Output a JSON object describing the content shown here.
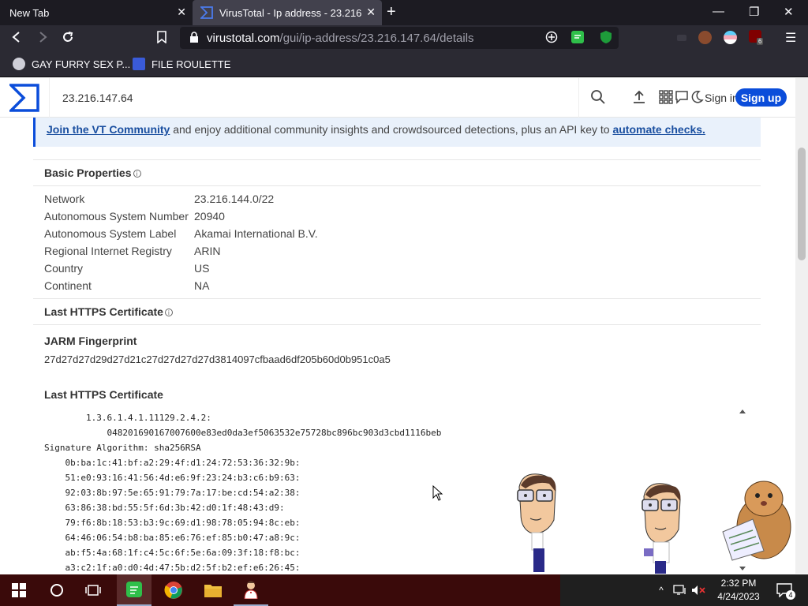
{
  "browser": {
    "tabs": [
      {
        "title": "New Tab",
        "active": false
      },
      {
        "title": "VirusTotal - Ip address - 23.216",
        "active": true
      }
    ],
    "url_host": "virustotal.com",
    "url_path": "/gui/ip-address/23.216.147.64/details",
    "bookmarks": [
      {
        "label": "GAY FURRY SEX P..."
      },
      {
        "label": "FILE ROULETTE"
      }
    ],
    "extension_badge": "6"
  },
  "vt": {
    "search_value": "23.216.147.64",
    "signin_label": "Sign in",
    "signup_label": "Sign up",
    "banner": {
      "link1": "Join the VT Community",
      "text": " and enjoy additional community insights and crowdsourced detections, plus an API key to ",
      "link2": "automate checks."
    },
    "basic_properties": {
      "title": "Basic Properties",
      "info_glyph": "i",
      "rows": [
        {
          "label": "Network",
          "value": "23.216.144.0/22"
        },
        {
          "label": "Autonomous System Number",
          "value": "20940"
        },
        {
          "label": "Autonomous System Label",
          "value": "Akamai International B.V."
        },
        {
          "label": "Regional Internet Registry",
          "value": "ARIN"
        },
        {
          "label": "Country",
          "value": "US"
        },
        {
          "label": "Continent",
          "value": "NA"
        }
      ]
    },
    "last_https_cert_heading": "Last HTTPS Certificate",
    "jarm": {
      "title": "JARM Fingerprint",
      "value": "27d27d27d29d27d21c27d27d27d27d3814097cfbaad6df205b60d0b951c0a5"
    },
    "cert_section_title": "Last HTTPS Certificate",
    "cert_lines": [
      "        1.3.6.1.4.1.11129.2.4.2:",
      "            048201690167007600e83ed0da3ef5063532e75728bc896bc903d3cbd1116beb",
      "Signature Algorithm: sha256RSA",
      "    0b:ba:1c:41:bf:a2:29:4f:d1:24:72:53:36:32:9b:",
      "    51:e0:93:16:41:56:4d:e6:9f:23:24:b3:c6:b9:63:",
      "    92:03:8b:97:5e:65:91:79:7a:17:be:cd:54:a2:38:",
      "    63:86:38:bd:55:5f:6d:3b:42:d0:1f:48:43:d9:",
      "    79:f6:8b:18:53:b3:9c:69:d1:98:78:05:94:8c:eb:",
      "    64:46:06:54:b8:ba:85:e6:76:ef:85:b0:47:a8:9c:",
      "    ab:f5:4a:68:1f:c4:5c:6f:5e:6a:09:3f:18:f8:bc:",
      "    a3:c2:1f:a0:d0:4d:47:5b:d2:5f:b2:ef:e6:26:45:"
    ]
  },
  "taskbar": {
    "time": "2:32 PM",
    "date": "4/24/2023",
    "notification_count": "4"
  },
  "colors": {
    "vt_blue": "#0b4dda",
    "chrome_dark": "#1c1b22",
    "taskbar": "#3a0a0a"
  }
}
